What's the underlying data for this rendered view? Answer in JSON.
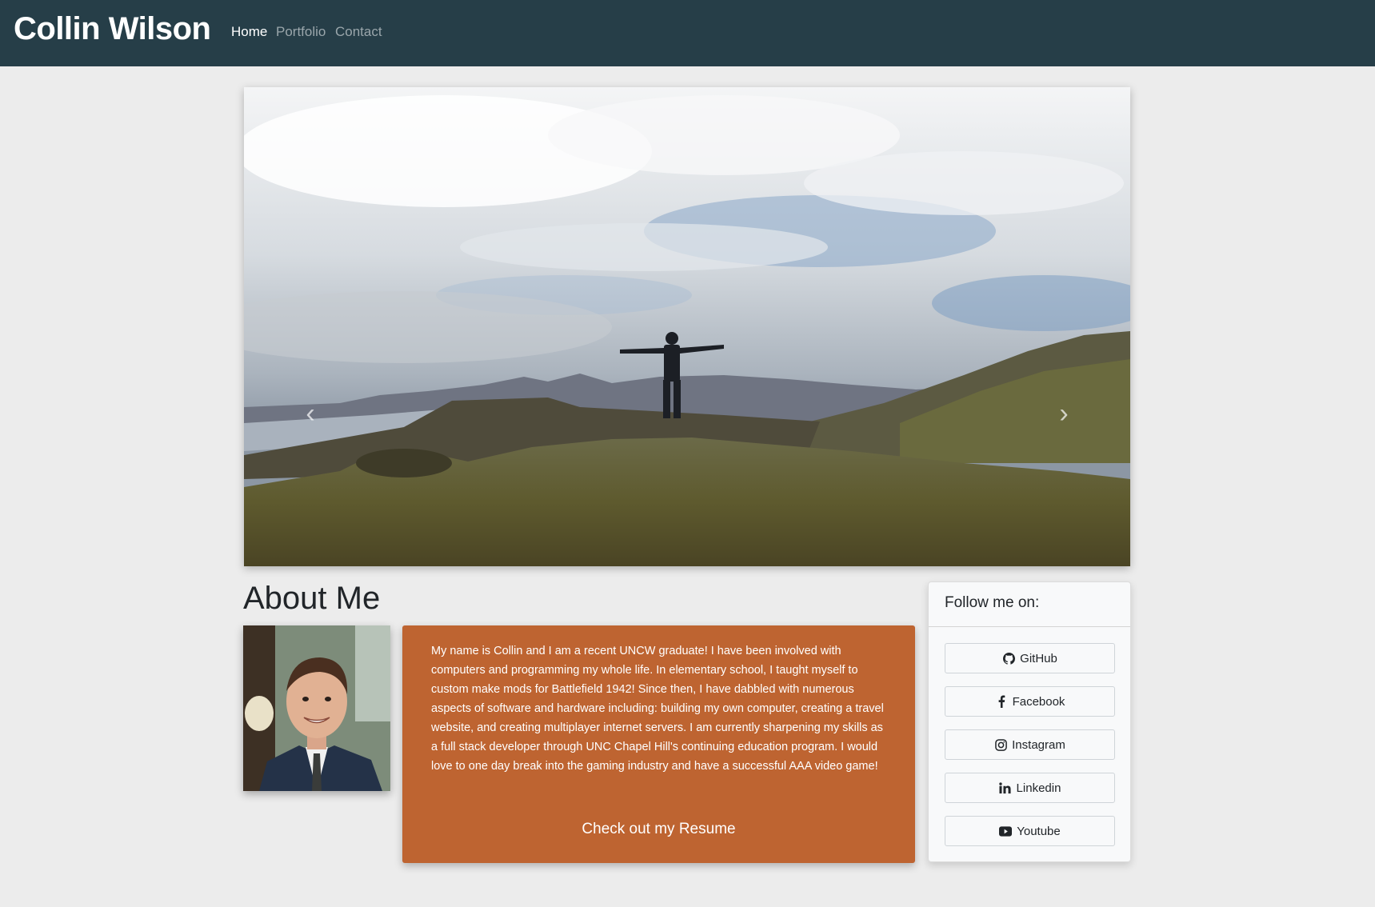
{
  "navbar": {
    "brand": "Collin Wilson",
    "links": [
      "Home",
      "Portfolio",
      "Contact"
    ],
    "active": "Home",
    "background_color": "#263e48"
  },
  "carousel": {
    "prev_icon": "chevron-left-icon",
    "next_icon": "chevron-right-icon"
  },
  "about": {
    "title": "About Me",
    "bio": "My name is Collin and I am a recent UNCW graduate! I have been involved with computers and programming my whole life. In elementary school, I taught myself to custom make mods for Battlefield 1942! Since then, I have dabbled with numerous aspects of software and hardware including: building my own computer, creating a travel website, and creating multiplayer internet servers. I am currently sharpening my skills as a full stack developer through UNC Chapel Hill's continuing education program. I would love to one day break into the gaming industry and have a successful AAA video game!",
    "resume_link": "Check out my Resume",
    "card_color": "#be6431"
  },
  "follow": {
    "title": "Follow me on:",
    "buttons": [
      {
        "label": "GitHub",
        "icon": "github-icon"
      },
      {
        "label": "Facebook",
        "icon": "facebook-icon"
      },
      {
        "label": "Instagram",
        "icon": "instagram-icon"
      },
      {
        "label": "Linkedin",
        "icon": "linkedin-icon"
      },
      {
        "label": "Youtube",
        "icon": "youtube-icon"
      }
    ]
  }
}
